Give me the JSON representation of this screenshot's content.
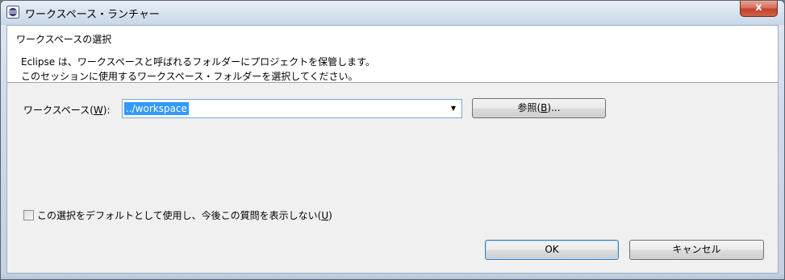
{
  "window": {
    "title": "ワークスペース・ランチャー",
    "close_symbol": "x",
    "icon": "eclipse-icon"
  },
  "header": {
    "title": "ワークスペースの選択",
    "description_line1": "Eclipse は、ワークスペースと呼ばれるフォルダーにプロジェクトを保管します。",
    "description_line2": "このセッションに使用するワークスペース・フォルダーを選択してください。"
  },
  "workspace": {
    "label_prefix": "ワークスペース(",
    "label_mnemonic": "W",
    "label_suffix": "):",
    "value": "../workspace",
    "dropdown_icon": "chevron-down-icon",
    "browse_prefix": "参照(",
    "browse_mnemonic": "B",
    "browse_suffix": ")..."
  },
  "default_option": {
    "label_prefix": "この選択をデフォルトとして使用し、今後この質問を表示しない(",
    "label_mnemonic": "U",
    "label_suffix": ")",
    "checked": false
  },
  "buttons": {
    "ok": "OK",
    "cancel": "キャンセル"
  }
}
